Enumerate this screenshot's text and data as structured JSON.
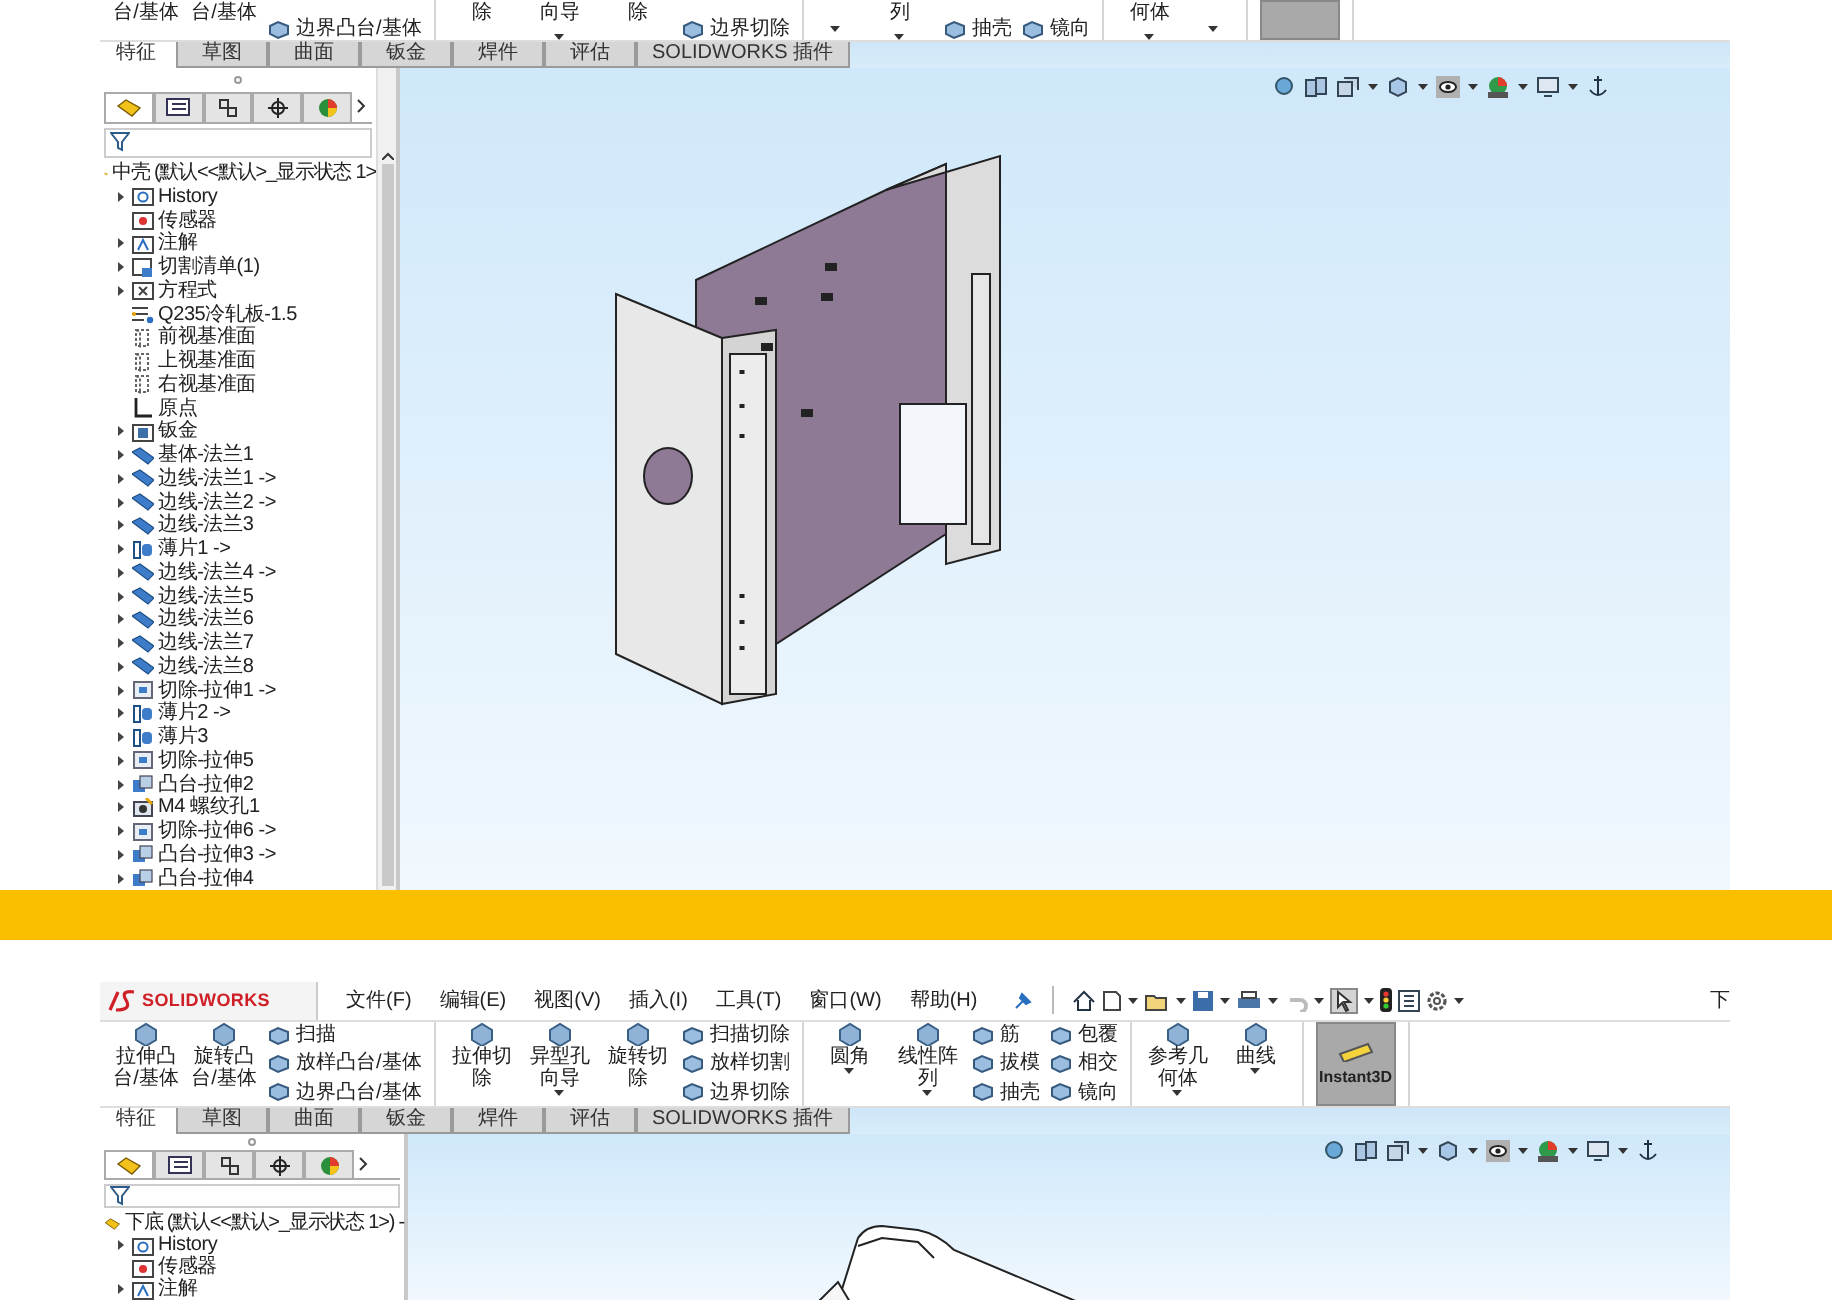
{
  "panels": [
    {
      "toolbar": {
        "cropped": true,
        "groups": [
          [
            {
              "kind": "large",
              "label": "台/基体"
            },
            {
              "kind": "large",
              "label": "台/基体"
            },
            {
              "kind": "stack",
              "items": [
                "边界凸台/基体"
              ]
            }
          ],
          [
            {
              "kind": "large",
              "label": "除"
            },
            {
              "kind": "large",
              "label": "向导",
              "dropdown": true
            },
            {
              "kind": "large",
              "label": "除"
            },
            {
              "kind": "stack",
              "items": [
                "边界切除"
              ]
            }
          ],
          [
            {
              "kind": "caret"
            },
            {
              "kind": "large",
              "label": "列",
              "dropdown": true
            },
            {
              "kind": "stack",
              "items": [
                "抽壳"
              ]
            },
            {
              "kind": "stack",
              "items": [
                "镜向"
              ]
            }
          ],
          [
            {
              "kind": "large",
              "label": "何体",
              "dropdown": true
            },
            {
              "kind": "caret"
            }
          ],
          [
            {
              "kind": "toggle",
              "selected": true
            }
          ]
        ]
      },
      "tabs": [
        {
          "label": "特征",
          "selected": true
        },
        {
          "label": "草图",
          "selected": false
        },
        {
          "label": "曲面",
          "selected": false
        },
        {
          "label": "钣金",
          "selected": false
        },
        {
          "label": "焊件",
          "selected": false
        },
        {
          "label": "评估",
          "selected": false
        },
        {
          "label": "SOLIDWORKS 插件",
          "selected": false
        }
      ],
      "tree": {
        "root": "中壳 (默认<<默认>_显示状态 1>",
        "scrollbar": true,
        "items": [
          {
            "label": "History",
            "kind": "history",
            "expandable": true
          },
          {
            "label": "传感器",
            "kind": "sensor",
            "expandable": false
          },
          {
            "label": "注解",
            "kind": "annotation",
            "expandable": true
          },
          {
            "label": "切割清单(1)",
            "kind": "cutlist",
            "expandable": true
          },
          {
            "label": "方程式",
            "kind": "equation",
            "expandable": true
          },
          {
            "label": "Q235冷轧板-1.5",
            "kind": "material",
            "expandable": false
          },
          {
            "label": "前视基准面",
            "kind": "plane",
            "expandable": false
          },
          {
            "label": "上视基准面",
            "kind": "plane",
            "expandable": false
          },
          {
            "label": "右视基准面",
            "kind": "plane",
            "expandable": false
          },
          {
            "label": "原点",
            "kind": "origin",
            "expandable": false
          },
          {
            "label": "钣金",
            "kind": "sheetmetal",
            "expandable": true
          },
          {
            "label": "基体-法兰1",
            "kind": "flange",
            "expandable": true
          },
          {
            "label": "边线-法兰1 ->",
            "kind": "flange",
            "expandable": true
          },
          {
            "label": "边线-法兰2 ->",
            "kind": "flange",
            "expandable": true
          },
          {
            "label": "边线-法兰3",
            "kind": "flange",
            "expandable": true
          },
          {
            "label": "薄片1 ->",
            "kind": "tab",
            "expandable": true
          },
          {
            "label": "边线-法兰4 ->",
            "kind": "flange",
            "expandable": true
          },
          {
            "label": "边线-法兰5",
            "kind": "flange",
            "expandable": true
          },
          {
            "label": "边线-法兰6",
            "kind": "flange",
            "expandable": true
          },
          {
            "label": "边线-法兰7",
            "kind": "flange",
            "expandable": true
          },
          {
            "label": "边线-法兰8",
            "kind": "flange",
            "expandable": true
          },
          {
            "label": "切除-拉伸1 ->",
            "kind": "cut",
            "expandable": true
          },
          {
            "label": "薄片2 ->",
            "kind": "tab",
            "expandable": true
          },
          {
            "label": "薄片3",
            "kind": "tab",
            "expandable": true
          },
          {
            "label": "切除-拉伸5",
            "kind": "cut",
            "expandable": true
          },
          {
            "label": "凸台-拉伸2",
            "kind": "boss",
            "expandable": true
          },
          {
            "label": "M4 螺纹孔1",
            "kind": "hole",
            "expandable": true
          },
          {
            "label": "切除-拉伸6 ->",
            "kind": "cut",
            "expandable": true
          },
          {
            "label": "凸台-拉伸3 ->",
            "kind": "boss",
            "expandable": true
          },
          {
            "label": "凸台-拉伸4",
            "kind": "boss",
            "expandable": true
          }
        ]
      }
    },
    {
      "menu_bar": {
        "brand": "SOLIDWORKS",
        "menus": [
          "文件(F)",
          "编辑(E)",
          "视图(V)",
          "插入(I)",
          "工具(T)",
          "窗口(W)",
          "帮助(H)"
        ],
        "title": "下"
      },
      "toolbar": {
        "cropped": false,
        "groups": [
          [
            {
              "kind": "large",
              "label": "拉伸凸台/基体"
            },
            {
              "kind": "large",
              "label": "旋转凸台/基体"
            },
            {
              "kind": "stack",
              "items": [
                "扫描",
                "放样凸台/基体",
                "边界凸台/基体"
              ]
            }
          ],
          [
            {
              "kind": "large",
              "label": "拉伸切除"
            },
            {
              "kind": "large",
              "label": "异型孔向导",
              "dropdown": true
            },
            {
              "kind": "large",
              "label": "旋转切除"
            },
            {
              "kind": "stack",
              "items": [
                "扫描切除",
                "放样切割",
                "边界切除"
              ]
            }
          ],
          [
            {
              "kind": "large",
              "label": "圆角",
              "dropdown": true
            },
            {
              "kind": "large",
              "label": "线性阵列",
              "dropdown": true
            },
            {
              "kind": "stack",
              "items": [
                "筋",
                "拔模",
                "抽壳"
              ]
            },
            {
              "kind": "stack",
              "items": [
                "包覆",
                "相交",
                "镜向"
              ]
            }
          ],
          [
            {
              "kind": "large",
              "label": "参考几何体",
              "dropdown": true
            },
            {
              "kind": "large",
              "label": "曲线",
              "dropdown": true
            }
          ],
          [
            {
              "kind": "toggle",
              "label": "Instant3D",
              "selected": true
            }
          ]
        ]
      },
      "tabs": [
        {
          "label": "特征",
          "selected": true
        },
        {
          "label": "草图",
          "selected": false
        },
        {
          "label": "曲面",
          "selected": false
        },
        {
          "label": "钣金",
          "selected": false
        },
        {
          "label": "焊件",
          "selected": false
        },
        {
          "label": "评估",
          "selected": false
        },
        {
          "label": "SOLIDWORKS 插件",
          "selected": false
        }
      ],
      "tree": {
        "root": "下底 (默认<<默认>_显示状态 1>) -",
        "scrollbar": false,
        "items": [
          {
            "label": "History",
            "kind": "history",
            "expandable": true
          },
          {
            "label": "传感器",
            "kind": "sensor",
            "expandable": false
          },
          {
            "label": "注解",
            "kind": "annotation",
            "expandable": true
          }
        ]
      }
    }
  ]
}
